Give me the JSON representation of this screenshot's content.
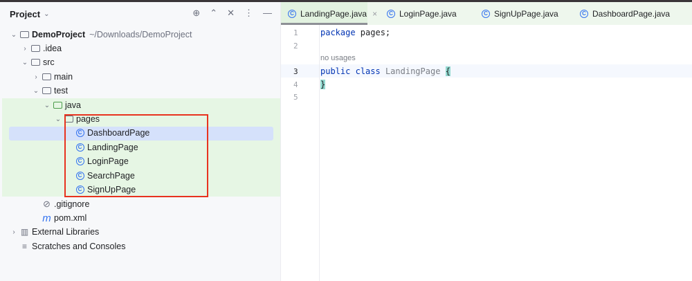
{
  "project_panel": {
    "title": "Project",
    "tools": [
      "locate-icon",
      "expand-icon",
      "collapse-icon",
      "more-icon",
      "minimize-icon"
    ],
    "tree": [
      {
        "label": "DemoProject",
        "path": "~/Downloads/DemoProject",
        "depth": 0,
        "chevron": "down",
        "icon": "project-folder"
      },
      {
        "label": ".idea",
        "depth": 1,
        "chevron": "right",
        "icon": "folder"
      },
      {
        "label": "src",
        "depth": 1,
        "chevron": "down",
        "icon": "folder"
      },
      {
        "label": "main",
        "depth": 2,
        "chevron": "right",
        "icon": "folder"
      },
      {
        "label": "test",
        "depth": 2,
        "chevron": "down",
        "icon": "folder"
      },
      {
        "label": "java",
        "depth": 3,
        "chevron": "down",
        "icon": "test-folder"
      },
      {
        "label": "pages",
        "depth": 4,
        "chevron": "down",
        "icon": "package"
      },
      {
        "label": "DashboardPage",
        "depth": 5,
        "icon": "class",
        "selected": true
      },
      {
        "label": "LandingPage",
        "depth": 5,
        "icon": "class"
      },
      {
        "label": "LoginPage",
        "depth": 5,
        "icon": "class"
      },
      {
        "label": "SearchPage",
        "depth": 5,
        "icon": "class"
      },
      {
        "label": "SignUpPage",
        "depth": 5,
        "icon": "class"
      },
      {
        "label": ".gitignore",
        "depth": 2,
        "icon": "ignore"
      },
      {
        "label": "pom.xml",
        "depth": 2,
        "icon": "maven"
      },
      {
        "label": "External Libraries",
        "depth": 0,
        "chevron": "right",
        "icon": "libraries"
      },
      {
        "label": "Scratches and Consoles",
        "depth": 0,
        "icon": "scratches"
      }
    ]
  },
  "editor": {
    "tabs": [
      {
        "label": "LandingPage.java",
        "active": true
      },
      {
        "label": "LoginPage.java"
      },
      {
        "label": "SignUpPage.java"
      },
      {
        "label": "DashboardPage.java"
      }
    ],
    "line_numbers": [
      "1",
      "2",
      "3",
      "4",
      "5"
    ],
    "hint": "no usages",
    "code": {
      "l1_kw": "package",
      "l1_rest": " pages;",
      "l3_kw1": "public",
      "l3_kw2": "class",
      "l3_name": "LandingPage",
      "l3_brace": "{",
      "l4_brace": "}"
    }
  },
  "colors": {
    "accent": "#3574f0",
    "highlight_box": "#e8321e",
    "test_bg": "#e6f6e4"
  }
}
